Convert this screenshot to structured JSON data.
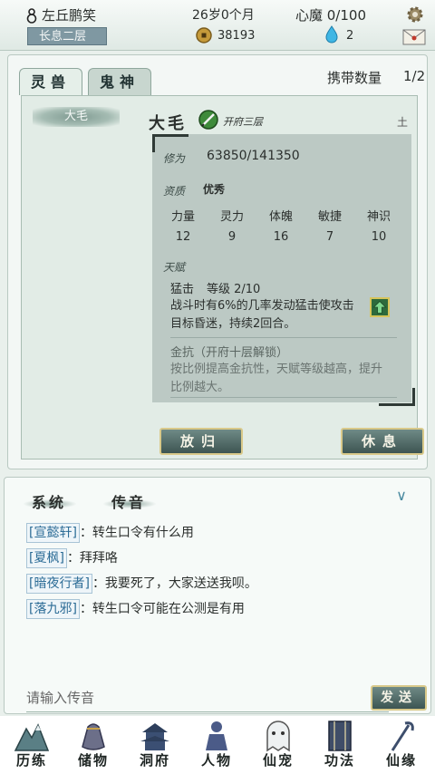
{
  "topbar": {
    "name": "左丘鹏笑",
    "age": "26岁0个月",
    "xinmo": "心魔 0/100",
    "realm": "长息二层",
    "coins": "38193",
    "crystals": "2"
  },
  "pet_panel": {
    "tabs": [
      "灵兽",
      "鬼神"
    ],
    "carry_label": "携带数量",
    "carry_value": "1/2",
    "pet_list": [
      "大毛"
    ],
    "pet": {
      "name": "大毛",
      "realm": "开府三层",
      "element": "土",
      "cultivation_label": "修为",
      "cultivation_value": "63850/141350",
      "aptitude_label": "资质",
      "aptitude_value": "优秀",
      "attributes": [
        {
          "name": "力量",
          "value": "12"
        },
        {
          "name": "灵力",
          "value": "9"
        },
        {
          "name": "体魄",
          "value": "16"
        },
        {
          "name": "敏捷",
          "value": "7"
        },
        {
          "name": "神识",
          "value": "10"
        }
      ],
      "talent_label": "天赋",
      "skill": {
        "name": "猛击",
        "level": "等级 2/10",
        "desc": "战斗时有6%的几率发动猛击使攻击目标昏迷，持续2回合。"
      },
      "locked_skill": {
        "name": "金抗（开府十层解锁）",
        "desc": "按比例提高金抗性，天赋等级越高，提升比例越大。"
      }
    },
    "buttons": {
      "release": "放归",
      "rest": "休息"
    }
  },
  "chat": {
    "tabs": [
      "系统",
      "传音"
    ],
    "messages": [
      {
        "name": "[宣懿轩]",
        "text": "：转生口令有什么用"
      },
      {
        "name": "[夏枫]",
        "text": "：拜拜咯"
      },
      {
        "name": "[暗夜行者]",
        "text": "：我要死了，大家送送我呗。"
      },
      {
        "name": "[落九邪]",
        "text": "：转生口令可能在公测是有用"
      }
    ],
    "input_placeholder": "请输入传音",
    "send_label": "发送"
  },
  "nav": [
    "历练",
    "储物",
    "洞府",
    "人物",
    "仙宠",
    "功法",
    "仙缘"
  ],
  "colors": {
    "accent_gold": "#d9c98a",
    "button_teal": "#3d5552",
    "link_blue": "#2c6c96"
  }
}
